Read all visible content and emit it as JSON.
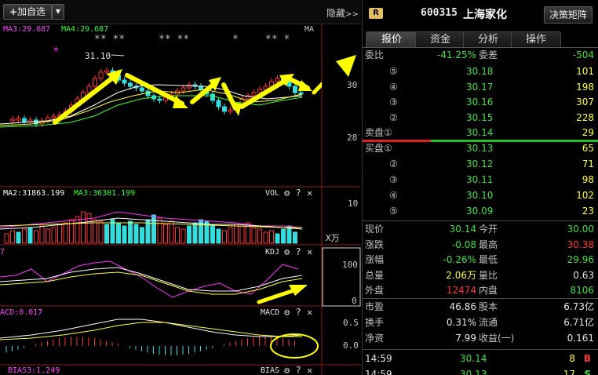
{
  "toolbar": {
    "add_watchlist": "加自选",
    "hide": "隐藏",
    "hide_arrow": ">>"
  },
  "main_chart": {
    "ma3": "MA3:29.687",
    "ma4": "MA4:29.687",
    "ma_tag": "MA",
    "high_label": "31.10",
    "price_ticks": [
      "30",
      "28"
    ]
  },
  "vol_panel": {
    "ma2": "MA2:31863.199",
    "ma3": "MA3:36301.199",
    "name": "VOL",
    "tick_top": "10",
    "unit": "X万"
  },
  "kdj_panel": {
    "left_value": "7",
    "name": "KDJ",
    "ticks": [
      "100",
      "0"
    ]
  },
  "macd_panel": {
    "value": "ACD:0.017",
    "name": "MACD",
    "ticks": [
      "0.5",
      "0.0"
    ]
  },
  "bias_panel": {
    "value": "BIAS3:1.249",
    "name": "BIAS"
  },
  "panel_icons": {
    "gear": "⚙",
    "help": "?",
    "close": "✕"
  },
  "stock": {
    "badge": "R",
    "code": "600315",
    "name": "上海家化",
    "matrix_button": "决策矩阵"
  },
  "tabs": [
    "报价",
    "资金",
    "分析",
    "操作"
  ],
  "order_book": {
    "ratio_label": "委比",
    "ratio_value": "-41.25%",
    "diff_label": "委差",
    "diff_value": "-504",
    "sell": [
      {
        "level": "⑤",
        "price": "30.18",
        "vol": "101"
      },
      {
        "level": "④",
        "price": "30.17",
        "vol": "198"
      },
      {
        "level": "③",
        "price": "30.16",
        "vol": "307"
      },
      {
        "level": "②",
        "price": "30.15",
        "vol": "228"
      },
      {
        "level": "卖盘①",
        "price": "30.14",
        "vol": "29"
      }
    ],
    "buy": [
      {
        "level": "买盘①",
        "price": "30.13",
        "vol": "65"
      },
      {
        "level": "②",
        "price": "30.12",
        "vol": "71"
      },
      {
        "level": "③",
        "price": "30.11",
        "vol": "98"
      },
      {
        "level": "④",
        "price": "30.10",
        "vol": "102"
      },
      {
        "level": "⑤",
        "price": "30.09",
        "vol": "23"
      }
    ]
  },
  "quote": [
    {
      "l1": "现价",
      "v1": "30.14",
      "c1": "green",
      "l2": "今开",
      "v2": "30.00",
      "c2": "green"
    },
    {
      "l1": "涨跌",
      "v1": "-0.08",
      "c1": "green",
      "l2": "最高",
      "v2": "30.38",
      "c2": "red"
    },
    {
      "l1": "涨幅",
      "v1": "-0.26%",
      "c1": "green",
      "l2": "最低",
      "v2": "29.96",
      "c2": "green"
    },
    {
      "l1": "总量",
      "v1": "2.06万",
      "c1": "yellow",
      "l2": "量比",
      "v2": "0.63",
      "c2": "white"
    },
    {
      "l1": "外盘",
      "v1": "12474",
      "c1": "red",
      "l2": "内盘",
      "v2": "8106",
      "c2": "green"
    }
  ],
  "fundamentals": [
    {
      "l1": "市盈",
      "v1": "46.86",
      "l2": "股本",
      "v2": "6.73亿"
    },
    {
      "l1": "换手",
      "v1": "0.31%",
      "l2": "流通",
      "v2": "6.71亿"
    },
    {
      "l1": "净资",
      "v1": "7.99",
      "l2": "收益(一)",
      "v2": "0.161"
    }
  ],
  "ticks": [
    {
      "time": "14:59",
      "price": "30.14",
      "vol": "8",
      "side": "B"
    },
    {
      "time": "14:59",
      "price": "30.13",
      "vol": "17",
      "side": "S"
    }
  ]
}
